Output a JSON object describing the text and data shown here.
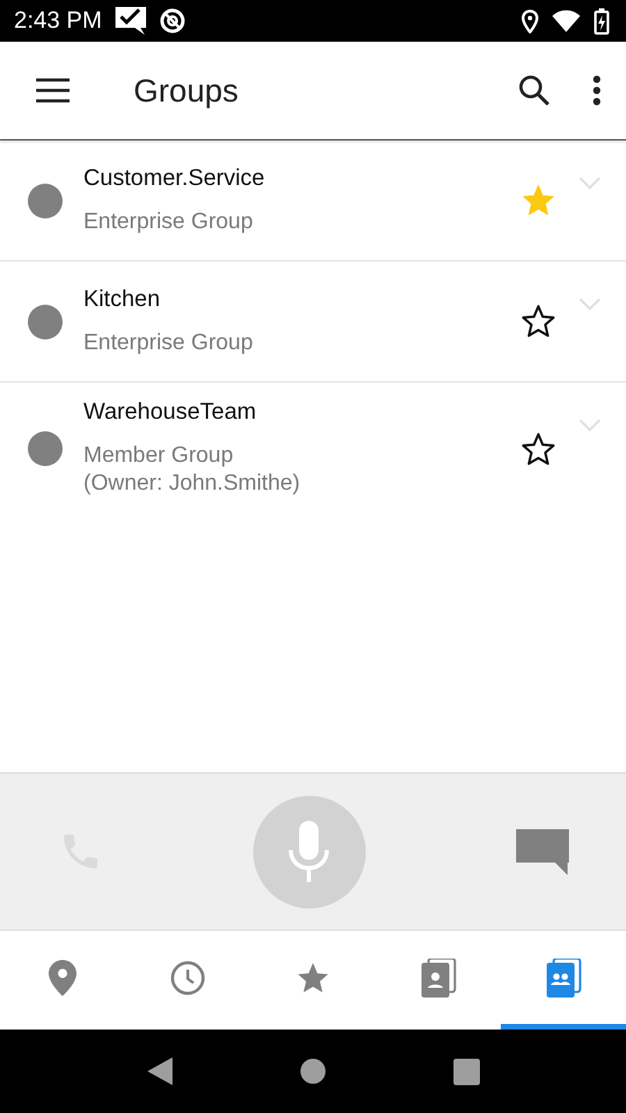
{
  "status_bar": {
    "time": "2:43 PM"
  },
  "app_bar": {
    "title": "Groups"
  },
  "groups": [
    {
      "name": "Customer.Service",
      "details": [
        "Enterprise Group"
      ],
      "favorite": true
    },
    {
      "name": "Kitchen",
      "details": [
        "Enterprise Group"
      ],
      "favorite": false
    },
    {
      "name": "WarehouseTeam",
      "details": [
        "Member Group",
        "(Owner: John.Smithe)"
      ],
      "favorite": false
    }
  ],
  "tabs": [
    {
      "kind": "location",
      "selected": false
    },
    {
      "kind": "history",
      "selected": false
    },
    {
      "kind": "favorites",
      "selected": false
    },
    {
      "kind": "contacts",
      "selected": false
    },
    {
      "kind": "groups",
      "selected": true
    }
  ]
}
